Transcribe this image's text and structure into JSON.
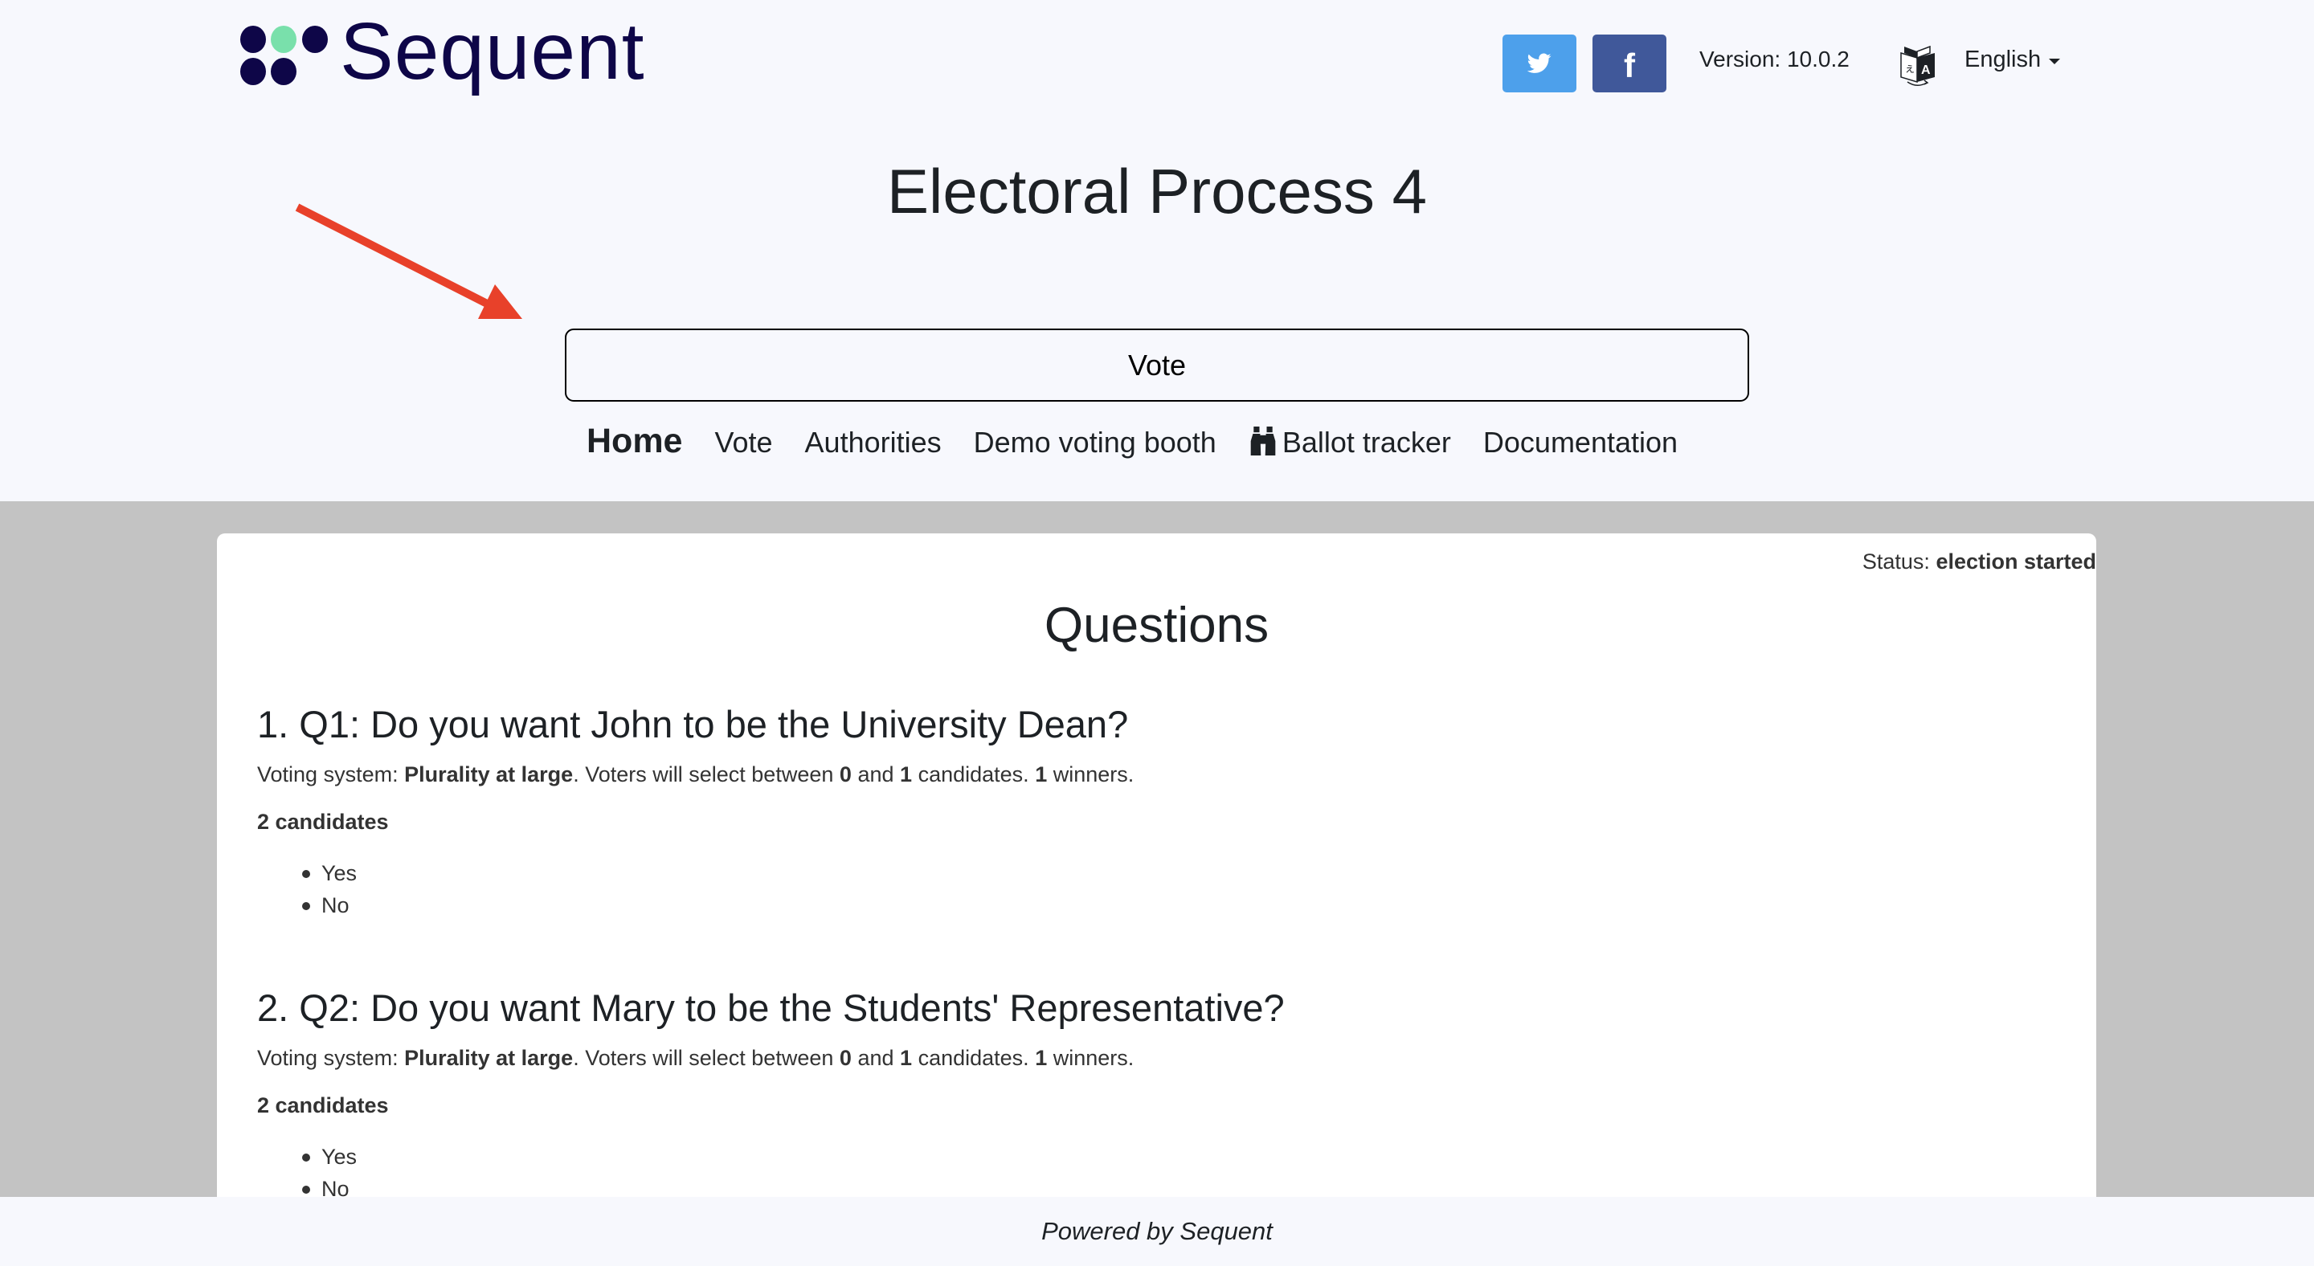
{
  "header": {
    "logo_text": "Sequent",
    "social": {
      "twitter_icon": "twitter-icon",
      "facebook_icon": "facebook-icon",
      "facebook_glyph": "f",
      "twitter_color": "#4DA0EB",
      "facebook_color": "#40589A"
    },
    "version": "Version: 10.0.2",
    "language": {
      "icon": "translate-icon",
      "selected": "English"
    }
  },
  "page": {
    "title": "Electoral Process 4",
    "vote_button": "Vote",
    "annotation_arrow_color": "#E8412A"
  },
  "nav": {
    "items": [
      {
        "label": "Home",
        "active": true
      },
      {
        "label": "Vote"
      },
      {
        "label": "Authorities"
      },
      {
        "label": "Demo voting booth"
      },
      {
        "label": "Ballot tracker",
        "icon": "binoculars-icon"
      },
      {
        "label": "Documentation"
      }
    ]
  },
  "main": {
    "status_label": "Status:",
    "status_value": "election started",
    "section_title": "Questions",
    "questions": [
      {
        "title": "1. Q1: Do you want John to be the University Dean?",
        "voting_system_label": "Voting system:",
        "voting_system": "Plurality at large",
        "select_text_1": ". Voters will select between",
        "min": "0",
        "select_text_2": "and",
        "max": "1",
        "select_text_3": "candidates.",
        "winners": "1",
        "winners_text": "winners.",
        "candidates_count": "2 candidates",
        "candidates": [
          "Yes",
          "No"
        ]
      },
      {
        "title": "2. Q2: Do you want Mary to be the Students' Representative?",
        "voting_system_label": "Voting system:",
        "voting_system": "Plurality at large",
        "select_text_1": ". Voters will select between",
        "min": "0",
        "select_text_2": "and",
        "max": "1",
        "select_text_3": "candidates.",
        "winners": "1",
        "winners_text": "winners.",
        "candidates_count": "2 candidates",
        "candidates": [
          "Yes",
          "No"
        ]
      }
    ]
  },
  "footer": {
    "text": "Powered by Sequent"
  }
}
